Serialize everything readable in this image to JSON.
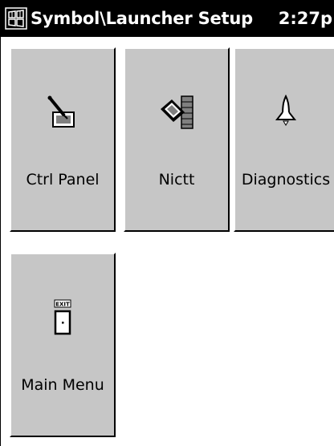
{
  "titlebar": {
    "title": "Symbol\\Launcher Setup",
    "clock": "2:27p",
    "start_icon": "windows-flag-icon"
  },
  "tiles": [
    {
      "label": "Ctrl Panel",
      "icon": "control-panel-pen-icon"
    },
    {
      "label": "Nictt",
      "icon": "network-card-icon"
    },
    {
      "label": "Diagnostics",
      "icon": "rocket-icon"
    },
    {
      "label": "Main Menu",
      "icon": "exit-door-icon",
      "icon_text": "EXIT"
    }
  ],
  "colors": {
    "titlebar": "#000000",
    "tile_face": "#c6c6c6",
    "background": "#ffffff"
  }
}
